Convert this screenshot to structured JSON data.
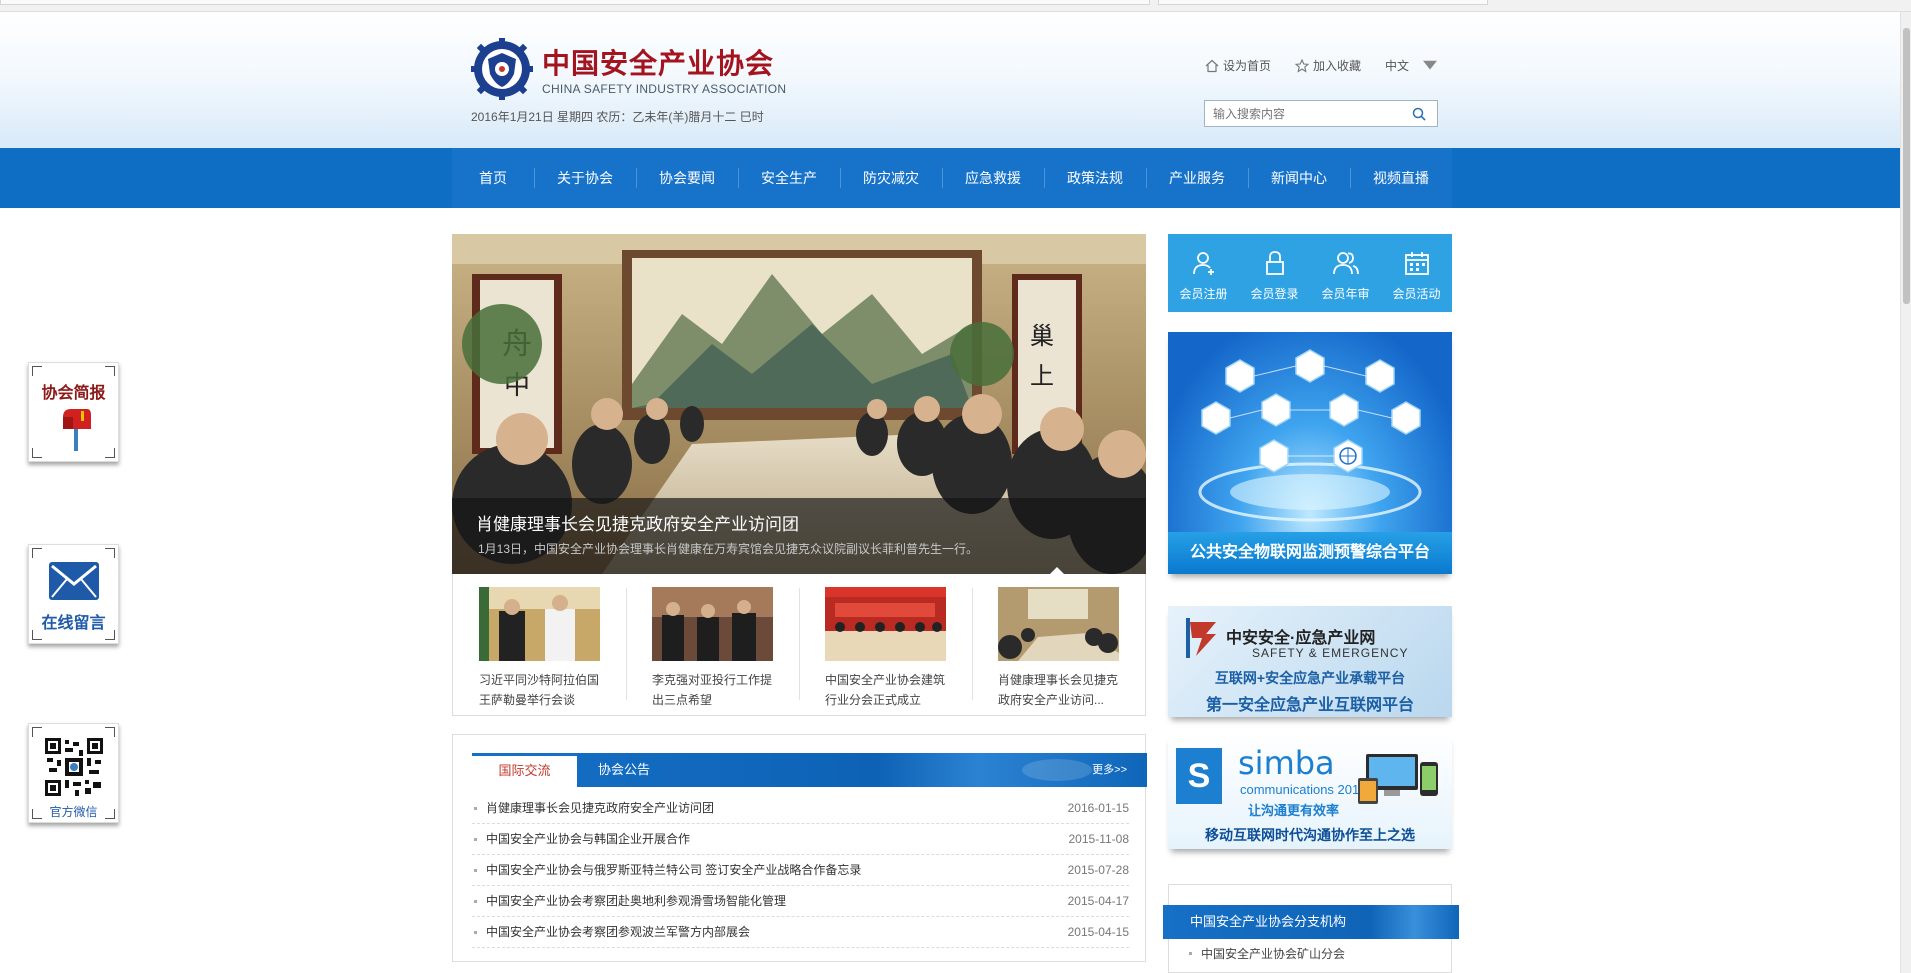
{
  "site": {
    "name_cn": "中国安全产业协会",
    "name_en": "CHINA SAFETY INDUSTRY ASSOCIATION",
    "date_line": "2016年1月21日 星期四 农历：乙未年(羊)腊月十二 巳时"
  },
  "top_links": {
    "set_home": "设为首页",
    "add_favorite": "加入收藏",
    "language": "中文"
  },
  "search": {
    "placeholder": "输入搜索内容"
  },
  "nav": [
    "首页",
    "关于协会",
    "协会要闻",
    "安全生产",
    "防灾减灾",
    "应急救援",
    "政策法规",
    "产业服务",
    "新闻中心",
    "视频直播"
  ],
  "float_widgets": {
    "bulletin": "协会简报",
    "message": "在线留言",
    "wechat": "官方微信"
  },
  "slider": {
    "title": "肖健康理事长会见捷克政府安全产业访问团",
    "desc": "1月13日，中国安全产业协会理事长肖健康在万寿宾馆会见捷克众议院副议长菲利普先生一行。"
  },
  "thumbs": [
    "习近平同沙特阿拉伯国王萨勒曼举行会谈",
    "李克强对亚投行工作提出三点希望",
    "中国安全产业协会建筑行业分会正式成立",
    "肖健康理事长会见捷克政府安全产业访问..."
  ],
  "news": {
    "tab_active": "国际交流",
    "tab_other": "协会公告",
    "more": "更多>>",
    "items": [
      {
        "title": "肖健康理事长会见捷克政府安全产业访问团",
        "date": "2016-01-15"
      },
      {
        "title": "中国安全产业协会与韩国企业开展合作",
        "date": "2015-11-08"
      },
      {
        "title": "中国安全产业协会与俄罗斯亚特兰特公司 签订安全产业战略合作备忘录",
        "date": "2015-07-28"
      },
      {
        "title": "中国安全产业协会考察团赴奥地利参观滑雪场智能化管理",
        "date": "2015-04-17"
      },
      {
        "title": "中国安全产业协会考察团参观波兰军警方内部展会",
        "date": "2015-04-15"
      }
    ]
  },
  "member": {
    "register": "会员注册",
    "login": "会员登录",
    "annual": "会员年审",
    "activity": "会员活动"
  },
  "banners": {
    "iot_caption": "公共安全物联网监测预警综合平台",
    "zhongan_name": "中安安全·应急产业网",
    "zhongan_en": "SAFETY & EMERGENCY",
    "zhongan_line1": "互联网+安全应急产业承载平台",
    "zhongan_line2": "第一安全应急产业互联网平台",
    "simba_logo": "S",
    "simba_name": "simba",
    "simba_sub": "communications 2015",
    "simba_cn": "让沟通更有效率",
    "simba_bottom": "移动互联网时代沟通协作至上之选"
  },
  "branch": {
    "title": "中国安全产业协会分支机构",
    "first_item": "中国安全产业协会矿山分会"
  },
  "colors": {
    "nav_blue": "#1773ca",
    "brand_red": "#a3141f",
    "member_blue": "#2fa2e4"
  }
}
